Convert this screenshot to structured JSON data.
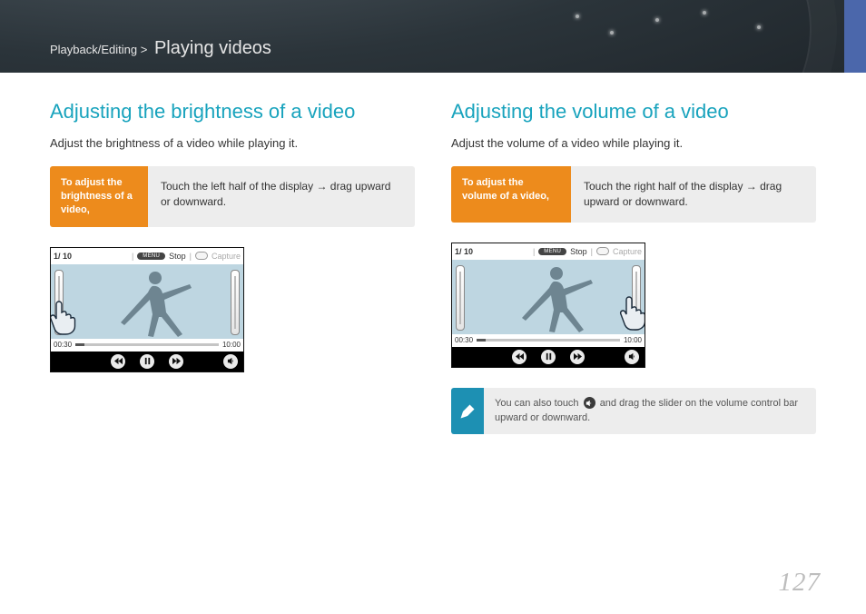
{
  "breadcrumb": {
    "section": "Playback/Editing",
    "sep": ">",
    "title": "Playing videos"
  },
  "left": {
    "heading": "Adjusting the brightness of a video",
    "lead": "Adjust the brightness of a video while playing it.",
    "instr_label": "To adjust the brightness of a video,",
    "instr_body": "Touch the left half of the display → drag upward or downward.",
    "player": {
      "counter": "1/ 10",
      "menu_chip": "MENU",
      "stop": "Stop",
      "capture": "Capture",
      "time_start": "00:30",
      "time_end": "10:00"
    }
  },
  "right": {
    "heading": "Adjusting the volume of a video",
    "lead": "Adjust the volume of a video while playing it.",
    "instr_label": "To adjust the volume of a video,",
    "instr_body": "Touch the right half of the display → drag upward or downward.",
    "player": {
      "counter": "1/ 10",
      "menu_chip": "MENU",
      "stop": "Stop",
      "capture": "Capture",
      "time_start": "00:30",
      "time_end": "10:00"
    },
    "note_pre": "You can also touch",
    "note_post": "and drag the slider on the volume control bar upward or downward."
  },
  "page_number": "127"
}
